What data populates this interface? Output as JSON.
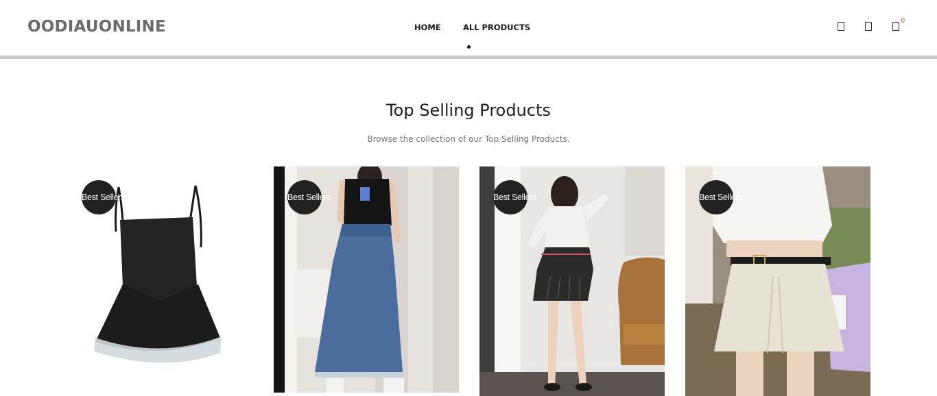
{
  "header": {
    "logo": "OODIAUONLINE",
    "nav": [
      {
        "label": "HOME"
      },
      {
        "label": "ALL PRODUCTS"
      }
    ],
    "icons": [
      "search-icon",
      "account-icon",
      "cart-icon"
    ],
    "cart_count": "0"
  },
  "section": {
    "title": "Top Selling Products",
    "subtitle": "Browse the collection of our Top Selling Products."
  },
  "products": [
    {
      "badge": "Best Sellers",
      "image": "black tiered mini dress"
    },
    {
      "badge": "Best Sellers",
      "image": "black tank top with long denim skirt"
    },
    {
      "badge": "Best Sellers",
      "image": "white top with pleated black mini skirt"
    },
    {
      "badge": "Best Sellers",
      "image": "white cropped shirt with cream skort and belt"
    }
  ],
  "colors": {
    "header_bar": "#c8c7cd",
    "badge_bg": "#222222",
    "cart_count": "#e5533d",
    "logo": "#6b6b6b"
  }
}
